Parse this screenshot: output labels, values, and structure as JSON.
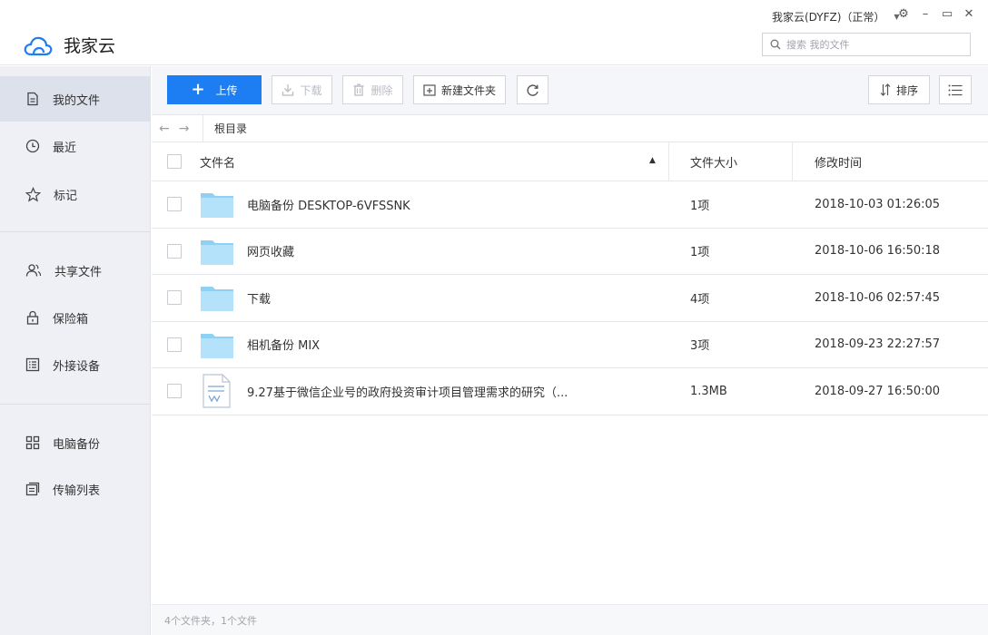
{
  "app": {
    "name": "我家云",
    "account": "我家云(DYFZ)（正常）",
    "brand_color": "#1d7ef4"
  },
  "window": {
    "controls": [
      "settings",
      "minimize",
      "maximize",
      "close"
    ]
  },
  "search": {
    "placeholder": "搜索 我的文件"
  },
  "sidebar": {
    "items": [
      {
        "label": "我的文件",
        "icon": "file-icon",
        "active": true
      },
      {
        "label": "最近",
        "icon": "clock-icon"
      },
      {
        "label": "标记",
        "icon": "star-icon"
      },
      {
        "label": "共享文件",
        "icon": "users-icon"
      },
      {
        "label": "保险箱",
        "icon": "lock-icon"
      },
      {
        "label": "外接设备",
        "icon": "list-icon"
      },
      {
        "label": "电脑备份",
        "icon": "grid-icon"
      },
      {
        "label": "传输列表",
        "icon": "transfer-icon"
      }
    ]
  },
  "toolbar": {
    "upload": "上传",
    "download": "下载",
    "delete": "删除",
    "new_folder": "新建文件夹",
    "sort": "排序"
  },
  "breadcrumb": {
    "path": "根目录"
  },
  "table": {
    "headers": {
      "name": "文件名",
      "size": "文件大小",
      "time": "修改时间"
    },
    "rows": [
      {
        "name": "电脑备份 DESKTOP-6VFSSNK",
        "size": "1项",
        "time": "2018-10-03 01:26:05",
        "type": "folder"
      },
      {
        "name": "网页收藏",
        "size": "1项",
        "time": "2018-10-06 16:50:18",
        "type": "folder"
      },
      {
        "name": "下载",
        "size": "4项",
        "time": "2018-10-06 02:57:45",
        "type": "folder"
      },
      {
        "name": "相机备份 MIX",
        "size": "3项",
        "time": "2018-09-23 22:27:57",
        "type": "folder"
      },
      {
        "name": "9.27基于微信企业号的政府投资审计项目管理需求的研究（...",
        "size": "1.3MB",
        "time": "2018-09-27 16:50:00",
        "type": "document"
      }
    ]
  },
  "status": {
    "summary": "4个文件夹，1个文件"
  }
}
